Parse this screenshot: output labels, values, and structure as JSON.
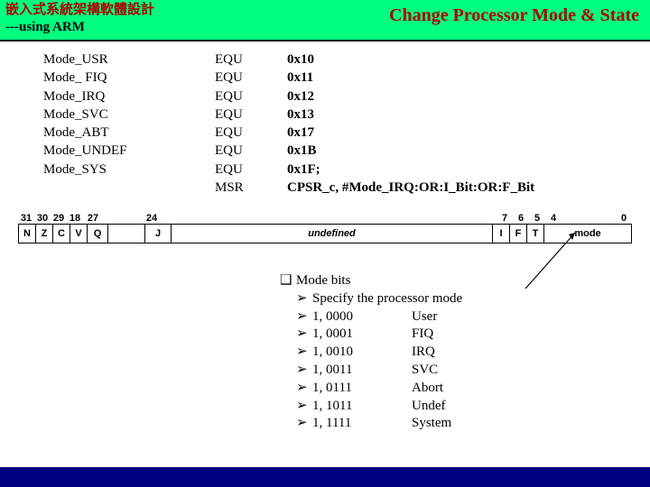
{
  "header": {
    "title_cjk": "嵌入式系統架構軟體設計",
    "subtitle": "---using ARM",
    "right": "Change Processor Mode & State"
  },
  "code": [
    {
      "label": "Mode_USR",
      "op": "EQU",
      "val": "0x10"
    },
    {
      "label": "Mode_ FIQ",
      "op": "EQU",
      "val": "0x11"
    },
    {
      "label": "Mode_IRQ",
      "op": "EQU",
      "val": "0x12"
    },
    {
      "label": "Mode_SVC",
      "op": "EQU",
      "val": "0x13"
    },
    {
      "label": "Mode_ABT",
      "op": "EQU",
      "val": "0x17"
    },
    {
      "label": "Mode_UNDEF",
      "op": "EQU",
      "val": "0x1B"
    },
    {
      "label": "Mode_SYS",
      "op": "EQU",
      "val": "0x1F;"
    },
    {
      "label": "",
      "op": "MSR",
      "val": "CPSR_c, #Mode_IRQ:OR:I_Bit:OR:F_Bit"
    }
  ],
  "reg": {
    "bits_left": [
      "31",
      "30",
      "29",
      "18",
      "27",
      "",
      "24"
    ],
    "bits_right": [
      "7",
      "6",
      "5",
      "4",
      "",
      "",
      "0"
    ],
    "cells_left": [
      "N",
      "Z",
      "C",
      "V",
      "Q",
      "",
      "J"
    ],
    "center": "undefined",
    "cells_right": [
      "I",
      "F",
      "T",
      "mode"
    ]
  },
  "modebits": {
    "heading": "Mode bits",
    "desc": "Specify the processor mode",
    "rows": [
      {
        "bits": "1, 0000",
        "name": "User"
      },
      {
        "bits": "1, 0001",
        "name": "FIQ"
      },
      {
        "bits": "1, 0010",
        "name": "IRQ"
      },
      {
        "bits": "1, 0011",
        "name": "SVC"
      },
      {
        "bits": "1, 0111",
        "name": "Abort"
      },
      {
        "bits": "1, 1011",
        "name": "Undef"
      },
      {
        "bits": "1, 1111",
        "name": "System"
      }
    ]
  }
}
